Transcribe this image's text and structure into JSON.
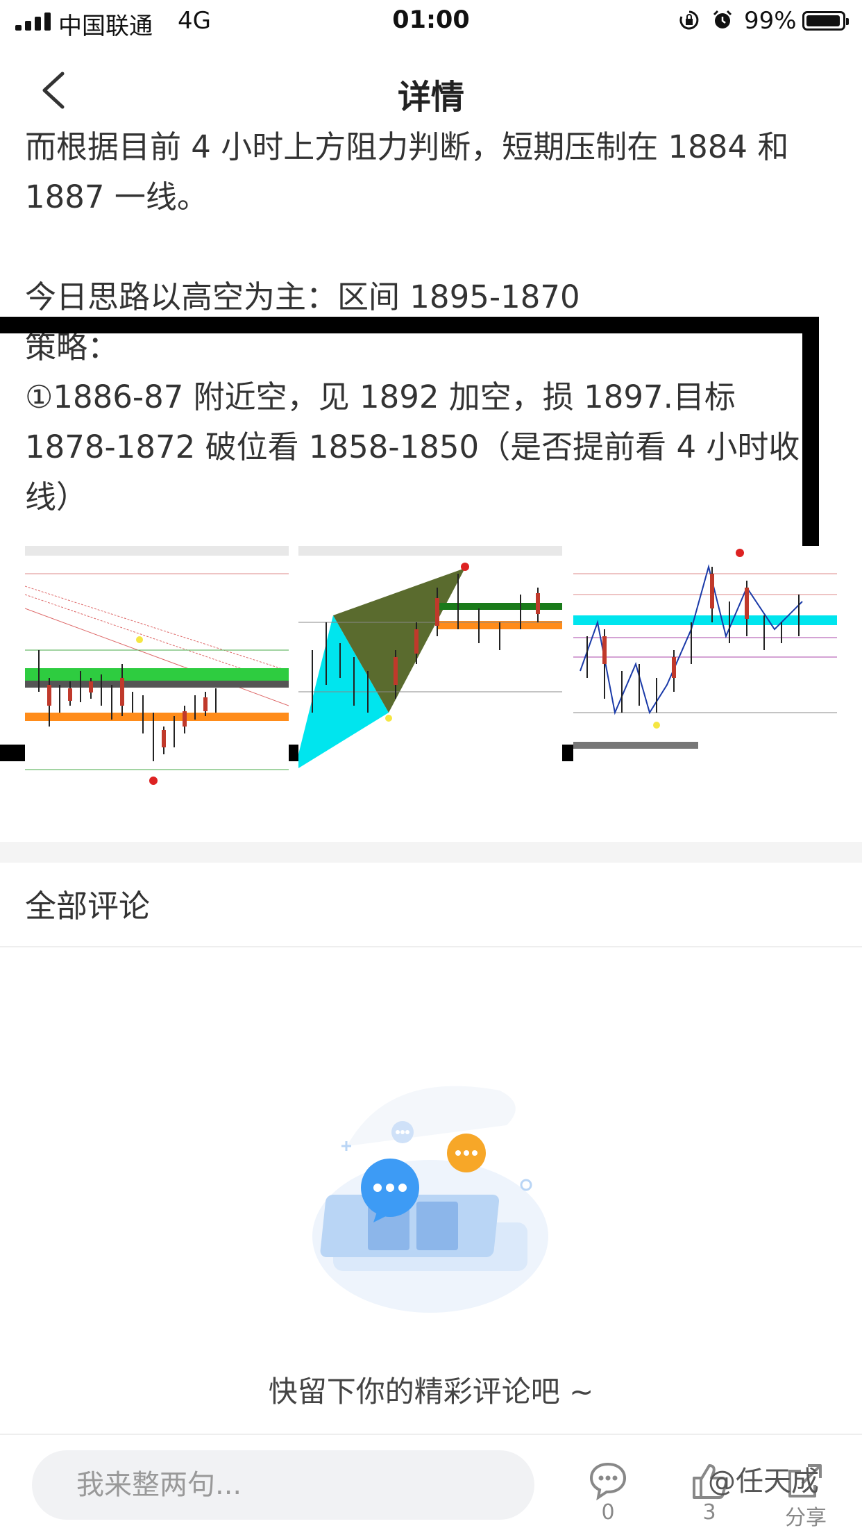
{
  "status_bar": {
    "carrier": "中国联通",
    "network": "4G",
    "time": "01:00",
    "battery_percent": "99%"
  },
  "nav": {
    "title": "详情"
  },
  "article": {
    "paragraph1": "而根据目前 4 小时上方阻力判断，短期压制在 1884 和 1887 一线。",
    "paragraph2": "今日思路以高空为主：区间 1895-1870",
    "strategy_label": "策略：",
    "strategy_item": "①1886-87 附近空，见 1892 加空，损 1897.目标 1878-1872 破位看 1858-1850（是否提前看 4 小时收线）"
  },
  "comments": {
    "title": "全部评论",
    "empty_text": "快留下你的精彩评论吧 ~"
  },
  "bottom_bar": {
    "input_placeholder": "我来整两句...",
    "comment_count": "0",
    "like_count": "3",
    "share_label": "分享"
  },
  "watermark": "@任天成",
  "colors": {
    "text": "#333333",
    "band_green": "#2ecc40",
    "band_orange": "#ff8c1a",
    "band_cyan": "#00e5ee",
    "pattern_olive": "#5a6b2e",
    "illustration_blue": "#3d9bf5",
    "illustration_orange": "#f7a728"
  },
  "icons": [
    "signal-icon",
    "lock-rotation-icon",
    "alarm-icon",
    "battery-icon",
    "back-chevron-icon",
    "comment-bubble-icon",
    "thumbs-up-icon",
    "share-icon"
  ]
}
